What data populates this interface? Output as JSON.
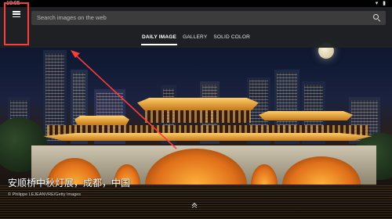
{
  "status_bar": {
    "time": "10:05",
    "icons": "▾ ▮"
  },
  "header": {
    "menu_icon": "hamburger-menu-icon",
    "search": {
      "placeholder": "Search images on the web",
      "icon": "search-icon"
    },
    "tabs": [
      {
        "label": "DAILY IMAGE",
        "active": true
      },
      {
        "label": "GALLERY",
        "active": false
      },
      {
        "label": "SOLID COLOR",
        "active": false
      }
    ]
  },
  "image": {
    "title": "安顺桥中秋灯展，成都，中国",
    "credit": "© Philippe LEJEANVRE/Getty Images",
    "expand_icon": "chevron-up-icon"
  },
  "annotation": {
    "highlight_color": "#ff3b3b",
    "type": "arrow-pointing-to-menu"
  }
}
